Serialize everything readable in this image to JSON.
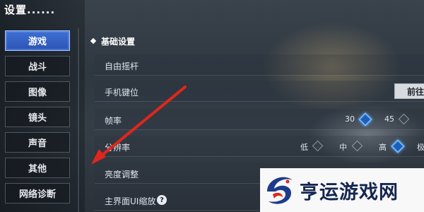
{
  "window": {
    "title": "设置......"
  },
  "sidebar": {
    "items": [
      {
        "label": "游戏",
        "active": true
      },
      {
        "label": "战斗"
      },
      {
        "label": "图像"
      },
      {
        "label": "镜头"
      },
      {
        "label": "声音"
      },
      {
        "label": "其他"
      },
      {
        "label": "网络诊断"
      }
    ]
  },
  "main": {
    "section_title": "基础设置",
    "rows": {
      "joystick": {
        "label": "自由摇杆"
      },
      "keybind": {
        "label": "手机键位",
        "button_label": "前往"
      },
      "framerate": {
        "label": "帧率",
        "options": [
          "30",
          "45"
        ],
        "selected": "30"
      },
      "resolution": {
        "label": "分辨率",
        "options": [
          "低",
          "中",
          "高",
          "极"
        ],
        "selected": "高"
      },
      "brightness": {
        "label": "亮度调整"
      },
      "ui_scale": {
        "label": "主界面UI缩放",
        "help_glyph": "?"
      }
    }
  },
  "watermark": {
    "text": "亨运游戏网"
  },
  "colors": {
    "accent": "#2c55b4",
    "arrow": "#e0261c",
    "watermark_text": "#14264f"
  }
}
